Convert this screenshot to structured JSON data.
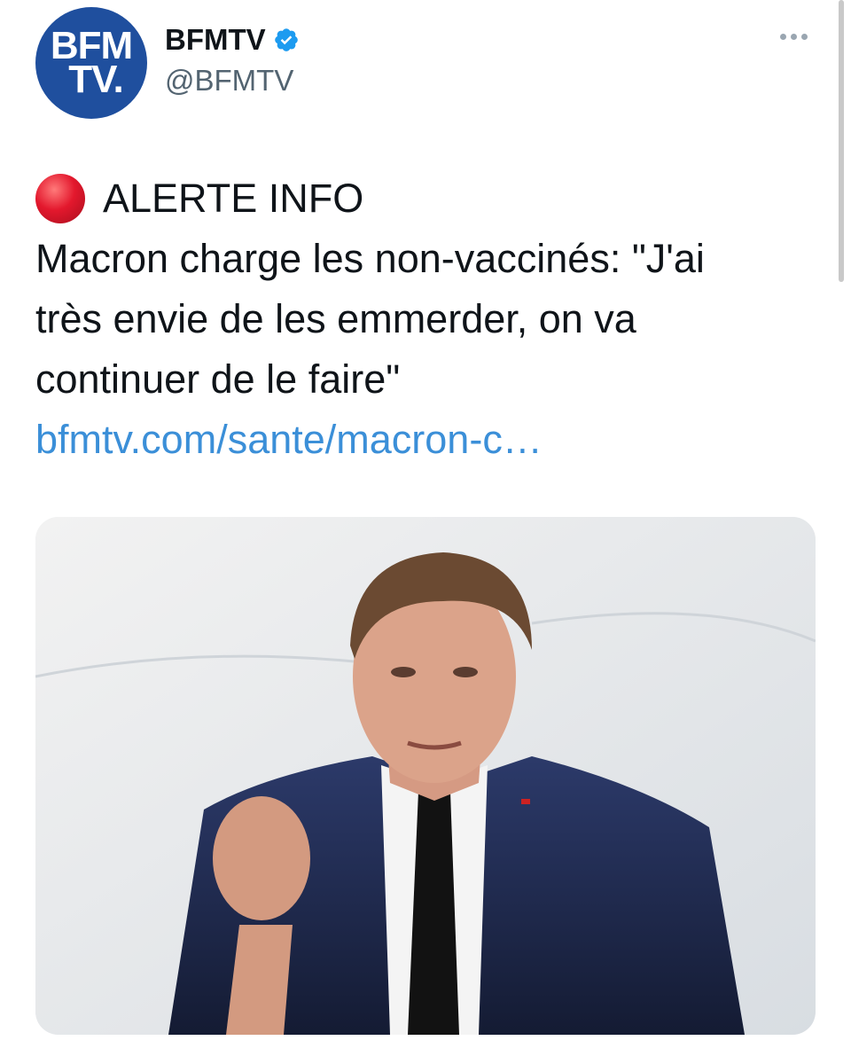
{
  "account": {
    "avatar_line1": "BFM",
    "avatar_line2": "TV.",
    "display_name": "BFMTV",
    "handle": "@BFMTV",
    "verified_icon": "verified-badge-icon",
    "more_icon": "more-options-icon"
  },
  "tweet": {
    "alert_emoji": "red-circle-icon",
    "alert_label": "ALERTE INFO",
    "text_line1": "Macron charge les non-vaccinés: \"J'ai",
    "text_line2": "très envie de les emmerder, on va",
    "text_line3": "continuer de le faire\"",
    "link": "bfmtv.com/sante/macron-c…"
  },
  "media": {
    "type": "photo"
  },
  "colors": {
    "brand_blue": "#1f4f9e",
    "verified_blue": "#1d9bf0",
    "link_blue": "#3b8fd8",
    "alert_red": "#e3182d"
  }
}
